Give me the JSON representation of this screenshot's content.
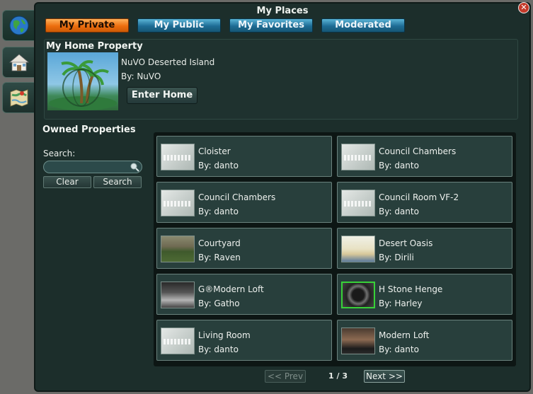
{
  "window": {
    "title": "My Places",
    "close_symbol": "✕"
  },
  "side_tabs": [
    {
      "name": "globe-icon"
    },
    {
      "name": "house-icon"
    },
    {
      "name": "map-icon"
    }
  ],
  "tabs": [
    {
      "label": "My Private",
      "active": true
    },
    {
      "label": "My Public",
      "active": false
    },
    {
      "label": "My Favorites",
      "active": false
    },
    {
      "label": "Moderated",
      "active": false
    }
  ],
  "home": {
    "section_title": "My Home Property",
    "name": "NuVO Deserted Island",
    "by": "By: NuVO",
    "enter_label": "Enter Home"
  },
  "owned": {
    "section_title": "Owned Properties",
    "search_label": "Search:",
    "search_value": "",
    "clear_label": "Clear",
    "search_button": "Search"
  },
  "properties": [
    {
      "name": "Cloister",
      "by": "By: danto",
      "thumb": "awaiting"
    },
    {
      "name": "Council Chambers",
      "by": "By: danto",
      "thumb": "awaiting"
    },
    {
      "name": "Council Chambers",
      "by": "By: danto",
      "thumb": "awaiting"
    },
    {
      "name": "Council Room VF-2",
      "by": "By: danto",
      "thumb": "awaiting"
    },
    {
      "name": "Courtyard",
      "by": "By: Raven",
      "thumb": "courtyard"
    },
    {
      "name": "Desert Oasis",
      "by": "By: Dirili",
      "thumb": "desert"
    },
    {
      "name": "G®Modern Loft",
      "by": "By: Gatho",
      "thumb": "loft"
    },
    {
      "name": "H Stone Henge",
      "by": "By: Harley",
      "thumb": "henge"
    },
    {
      "name": "Living Room",
      "by": "By: danto",
      "thumb": "awaiting"
    },
    {
      "name": "Modern Loft",
      "by": "By: danto",
      "thumb": "modern"
    }
  ],
  "pager": {
    "prev_label": "<< Prev",
    "page": "1 / 3",
    "next_label": "Next >>"
  }
}
